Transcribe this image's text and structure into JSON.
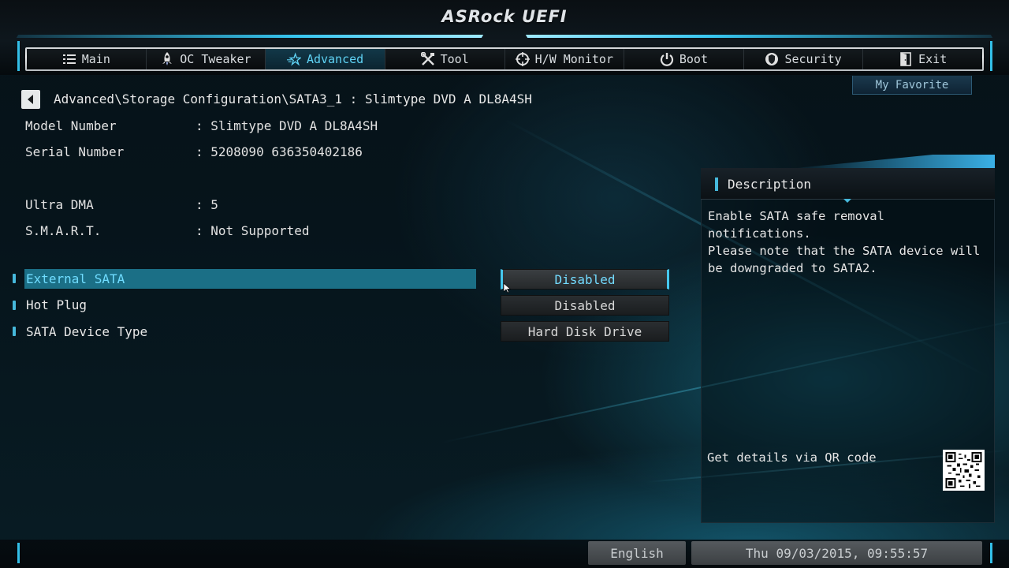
{
  "brand": "ASRock UEFI",
  "tabs": [
    {
      "label": "Main",
      "icon": "list-icon",
      "active": false
    },
    {
      "label": "OC Tweaker",
      "icon": "rocket-icon",
      "active": false
    },
    {
      "label": "Advanced",
      "icon": "star-icon",
      "active": true
    },
    {
      "label": "Tool",
      "icon": "tools-icon",
      "active": false
    },
    {
      "label": "H/W Monitor",
      "icon": "crosshair-icon",
      "active": false
    },
    {
      "label": "Boot",
      "icon": "power-icon",
      "active": false
    },
    {
      "label": "Security",
      "icon": "shield-icon",
      "active": false
    },
    {
      "label": "Exit",
      "icon": "exit-door-icon",
      "active": false
    }
  ],
  "my_favorite": "My Favorite",
  "breadcrumb": "Advanced\\Storage Configuration\\SATA3_1 : Slimtype DVD A  DL8A4SH",
  "info": [
    {
      "label": "Model Number",
      "value": ": Slimtype DVD A  DL8A4SH"
    },
    {
      "label": "Serial Number",
      "value": ": 5208090 636350402186"
    },
    {
      "label": "Ultra DMA",
      "value": ": 5"
    },
    {
      "label": "S.M.A.R.T.",
      "value": ": Not Supported"
    }
  ],
  "options": [
    {
      "label": "External SATA",
      "value": "Disabled",
      "selected": true
    },
    {
      "label": "Hot Plug",
      "value": "Disabled",
      "selected": false
    },
    {
      "label": "SATA Device Type",
      "value": "Hard Disk Drive",
      "selected": false
    }
  ],
  "description": {
    "title": "Description",
    "text": "Enable SATA safe removal notifications.\nPlease note that the SATA device will\nbe downgraded to SATA2.",
    "qr_label": "Get details via QR code"
  },
  "footer": {
    "language": "English",
    "datetime": "Thu 09/03/2015, 09:55:57"
  },
  "colors": {
    "accent": "#46b9dc",
    "selected_row": "#1b6f86",
    "selected_text": "#6fdcff"
  }
}
